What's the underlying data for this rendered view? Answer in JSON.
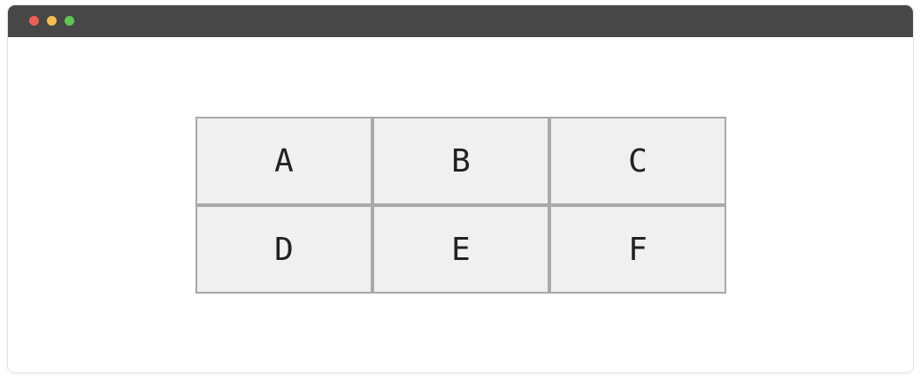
{
  "window": {
    "controls": [
      {
        "name": "close",
        "color": "#ec5f57"
      },
      {
        "name": "minimize",
        "color": "#f5be4f"
      },
      {
        "name": "maximize",
        "color": "#5fc454"
      }
    ]
  },
  "grid": {
    "rows": [
      [
        "A",
        "B",
        "C"
      ],
      [
        "D",
        "E",
        "F"
      ]
    ]
  },
  "colors": {
    "titlebar": "#474747",
    "cell_background": "#f0f0f0",
    "cell_border": "#a9a9a9",
    "text": "#222222"
  }
}
